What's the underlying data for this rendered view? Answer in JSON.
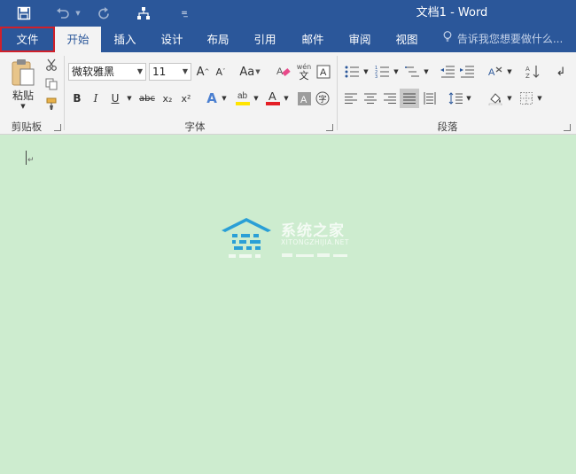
{
  "window": {
    "title": "文档1 - Word",
    "quick_access": {
      "save_icon": "save-icon",
      "undo_icon": "undo-icon",
      "redo_icon": "redo-icon",
      "touch_mode_icon": "touch-mode-icon",
      "customize_icon": "customize-qat-icon"
    }
  },
  "tabs": [
    "文件",
    "开始",
    "插入",
    "设计",
    "布局",
    "引用",
    "邮件",
    "审阅",
    "视图"
  ],
  "active_tab": "开始",
  "highlighted_tab": "文件",
  "tell_me": "告诉我您想要做什么...",
  "ribbon": {
    "clipboard": {
      "paste_label": "粘贴",
      "group_label": "剪贴板"
    },
    "font": {
      "font_name": "微软雅黑",
      "font_size": "11",
      "bold": "B",
      "italic": "I",
      "underline": "U",
      "strike": "abc",
      "subscript": "x₂",
      "superscript": "x²",
      "change_case": "Aa",
      "phonetic": "wén",
      "phonetic_char": "文",
      "group_label": "字体"
    },
    "paragraph": {
      "group_label": "段落"
    }
  },
  "document": {
    "watermark_title": "系统之家",
    "watermark_url": "XITONGZHIJIA.NET"
  },
  "colors": {
    "title_bar": "#2b579a",
    "ribbon": "#f3f3f3",
    "document_bg": "#cdeccf",
    "file_tab_highlight": "#d0202a",
    "font_color_bar": "#e41e25",
    "highlight_bar": "#ffe400"
  }
}
